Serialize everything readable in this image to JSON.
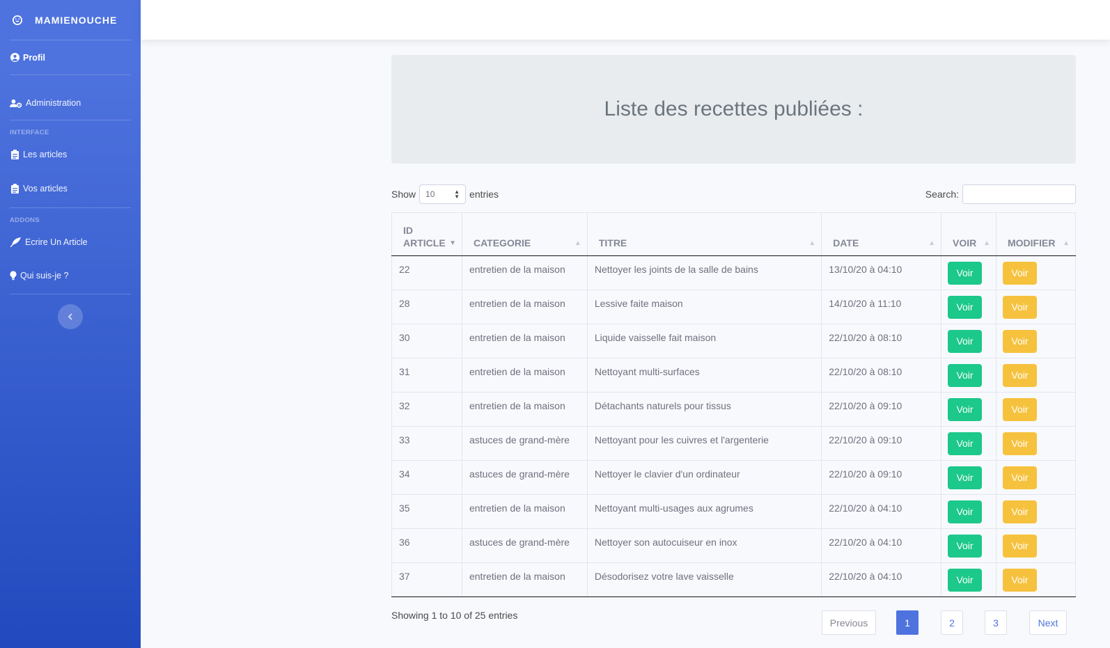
{
  "sidebar": {
    "brand": "MAMIENOUCHE",
    "profile": "Profil",
    "administration": "Administration",
    "heading_interface": "INTERFACE",
    "les_articles": "Les articles",
    "vos_articles": "Vos articles",
    "heading_addons": "ADDONS",
    "ecrire": "Ecrire Un Article",
    "qui": "Qui suis-je ?"
  },
  "page": {
    "title": "Liste des recettes publiées :"
  },
  "controls": {
    "show": "Show",
    "entries_value": "10",
    "entries": "entries",
    "search": "Search:"
  },
  "table": {
    "headers": {
      "id_line1": "ID",
      "id_line2": "ARTICLE",
      "categorie": "CATEGORIE",
      "titre": "TITRE",
      "date": "DATE",
      "voir": "VOIR",
      "modifier": "MODIFIER"
    },
    "rows": [
      {
        "id": "22",
        "categorie": "entretien de la maison",
        "titre": "Nettoyer les joints de la salle de bains",
        "date": "13/10/20 à 04:10",
        "voir": "Voir",
        "modifier": "Voir"
      },
      {
        "id": "28",
        "categorie": "entretien de la maison",
        "titre": "Lessive faite maison",
        "date": "14/10/20 à 11:10",
        "voir": "Voir",
        "modifier": "Voir"
      },
      {
        "id": "30",
        "categorie": "entretien de la maison",
        "titre": "Liquide vaisselle fait maison",
        "date": "22/10/20 à 08:10",
        "voir": "Voir",
        "modifier": "Voir"
      },
      {
        "id": "31",
        "categorie": "entretien de la maison",
        "titre": "Nettoyant multi-surfaces",
        "date": "22/10/20 à 08:10",
        "voir": "Voir",
        "modifier": "Voir"
      },
      {
        "id": "32",
        "categorie": "entretien de la maison",
        "titre": "Détachants naturels pour tissus",
        "date": "22/10/20 à 09:10",
        "voir": "Voir",
        "modifier": "Voir"
      },
      {
        "id": "33",
        "categorie": "astuces de grand-mère",
        "titre": "Nettoyant pour les cuivres et l'argenterie",
        "date": "22/10/20 à 09:10",
        "voir": "Voir",
        "modifier": "Voir"
      },
      {
        "id": "34",
        "categorie": "astuces de grand-mère",
        "titre": "Nettoyer le clavier d'un ordinateur",
        "date": "22/10/20 à 09:10",
        "voir": "Voir",
        "modifier": "Voir"
      },
      {
        "id": "35",
        "categorie": "entretien de la maison",
        "titre": "Nettoyant multi-usages aux agrumes",
        "date": "22/10/20 à 04:10",
        "voir": "Voir",
        "modifier": "Voir"
      },
      {
        "id": "36",
        "categorie": "astuces de grand-mère",
        "titre": "Nettoyer son autocuiseur en inox",
        "date": "22/10/20 à 04:10",
        "voir": "Voir",
        "modifier": "Voir"
      },
      {
        "id": "37",
        "categorie": "entretien de la maison",
        "titre": "Désodorisez votre lave vaisselle",
        "date": "22/10/20 à 04:10",
        "voir": "Voir",
        "modifier": "Voir"
      }
    ]
  },
  "footer": {
    "info": "Showing 1 to 10 of 25 entries",
    "previous": "Previous",
    "page1": "1",
    "page2": "2",
    "page3": "3",
    "next": "Next"
  },
  "colors": {
    "sidebar_top": "#4e73df",
    "sidebar_bottom": "#224abe",
    "voir_button": "#1cc88a",
    "modifier_button": "#f6c23e",
    "active_page": "#4e73df"
  },
  "icons": {
    "brand": "laugh-icon",
    "profile": "user-circle-icon",
    "administration": "user-cog-icon",
    "articles": "clipboard-icon",
    "ecrire": "feather-icon",
    "qui": "lightbulb-icon",
    "toggle": "chevron-left-icon"
  }
}
